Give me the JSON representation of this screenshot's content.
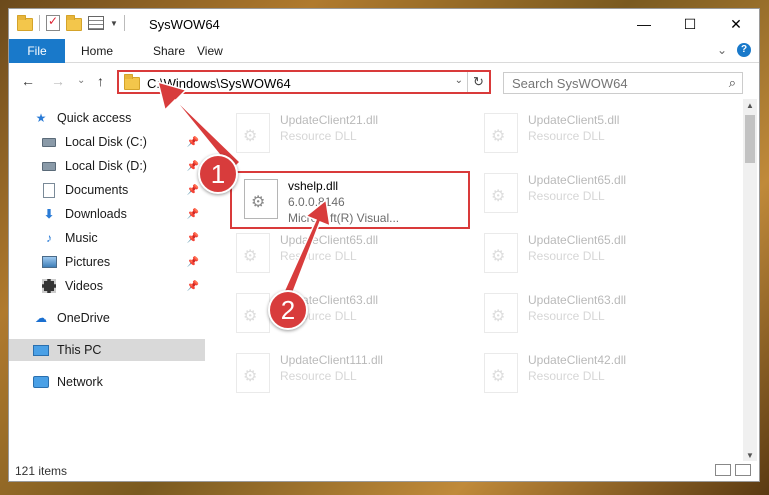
{
  "window": {
    "title": "SysWOW64",
    "controls": {
      "minimize": "—",
      "maximize": "☐",
      "close": "✕"
    }
  },
  "ribbon": {
    "tabs": [
      "File",
      "Home",
      "Share",
      "View"
    ],
    "collapse_glyph": "⌄",
    "help_glyph": "?"
  },
  "address": {
    "back": "←",
    "forward": "→",
    "recent": "⌄",
    "up": "↑",
    "path": "C:\\Windows\\SysWOW64",
    "dropdown": "⌄",
    "refresh": "↻",
    "search_placeholder": "Search SysWOW64",
    "search_glyph": "⌕"
  },
  "nav": {
    "quick_access": "Quick access",
    "items": [
      {
        "label": "Local Disk (C:)",
        "icon": "disk-icon",
        "pinned": true
      },
      {
        "label": "Local Disk (D:)",
        "icon": "disk-icon",
        "pinned": true
      },
      {
        "label": "Documents",
        "icon": "documents-icon",
        "pinned": true
      },
      {
        "label": "Downloads",
        "icon": "downloads-icon",
        "pinned": true
      },
      {
        "label": "Music",
        "icon": "music-icon",
        "pinned": true
      },
      {
        "label": "Pictures",
        "icon": "pictures-icon",
        "pinned": true
      },
      {
        "label": "Videos",
        "icon": "videos-icon",
        "pinned": true
      }
    ],
    "onedrive": "OneDrive",
    "this_pc": "This PC",
    "network": "Network",
    "pin_glyph": "📌"
  },
  "files": [
    {
      "name": "UpdateClient21.dll",
      "line2": "Resource DLL",
      "line3": "",
      "faded": true
    },
    {
      "name": "UpdateClient5.dll",
      "line2": "Resource DLL",
      "line3": "",
      "faded": true
    },
    {
      "name": "vshelp.dll",
      "line2": "6.0.0.8146",
      "line3": "Microsoft(R) Visual...",
      "faded": false
    },
    {
      "name": "UpdateClient65.dll",
      "line2": "Resource DLL",
      "line3": "",
      "faded": true
    },
    {
      "name": "UpdateClient65.dll",
      "line2": "Resource DLL",
      "line3": "",
      "faded": true
    },
    {
      "name": "UpdateClient65.dll",
      "line2": "Resource DLL",
      "line3": "",
      "faded": true
    },
    {
      "name": "UpdateClient63.dll",
      "line2": "Resource DLL",
      "line3": "",
      "faded": true
    },
    {
      "name": "UpdateClient63.dll",
      "line2": "Resource DLL",
      "line3": "",
      "faded": true
    },
    {
      "name": "UpdateClient111.dll",
      "line2": "Resource DLL",
      "line3": "",
      "faded": true
    },
    {
      "name": "UpdateClient42.dll",
      "line2": "Resource DLL",
      "line3": "",
      "faded": true
    }
  ],
  "status": {
    "count": "121 items"
  },
  "annotations": {
    "step1": "1",
    "step2": "2",
    "color": "#d83c3c"
  }
}
